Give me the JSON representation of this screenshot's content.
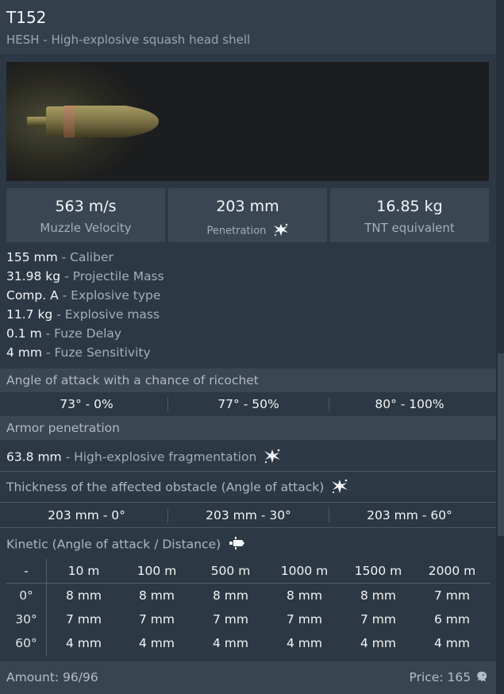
{
  "header": {
    "title": "T152",
    "subtitle": "HESH - High-explosive squash head shell"
  },
  "stats": [
    {
      "value": "563 m/s",
      "label": "Muzzle Velocity"
    },
    {
      "value": "203 mm",
      "label": "Penetration",
      "icon": "explosion-icon"
    },
    {
      "value": "16.85 kg",
      "label": "TNT equivalent"
    }
  ],
  "properties": [
    {
      "value": "155 mm",
      "desc": "- Caliber"
    },
    {
      "value": "31.98 kg",
      "desc": "- Projectile Mass"
    },
    {
      "value": "Comp. A",
      "desc": "- Explosive type"
    },
    {
      "value": "11.7 kg",
      "desc": "- Explosive mass"
    },
    {
      "value": "0.1 m",
      "desc": "- Fuze Delay"
    },
    {
      "value": "4 mm",
      "desc": "- Fuze Sensitivity"
    }
  ],
  "ricochet": {
    "title": "Angle of attack with a chance of ricochet",
    "cells": [
      "73° - 0%",
      "77° - 50%",
      "80° - 100%"
    ]
  },
  "armor": {
    "title": "Armor penetration",
    "frag_value": "63.8 mm",
    "frag_desc": "- High-explosive fragmentation",
    "thickness_title": "Thickness of the affected obstacle (Angle of attack)",
    "thickness_cells": [
      "203 mm - 0°",
      "203 mm - 30°",
      "203 mm - 60°"
    ],
    "kinetic_title": "Kinetic (Angle of attack / Distance)"
  },
  "kinetic_table": {
    "corner": "-",
    "distances": [
      "10 m",
      "100 m",
      "500 m",
      "1000 m",
      "1500 m",
      "2000 m"
    ],
    "rows": [
      {
        "angle": "0°",
        "values": [
          "8 mm",
          "8 mm",
          "8 mm",
          "8 mm",
          "8 mm",
          "7 mm"
        ]
      },
      {
        "angle": "30°",
        "values": [
          "7 mm",
          "7 mm",
          "7 mm",
          "7 mm",
          "7 mm",
          "6 mm"
        ]
      },
      {
        "angle": "60°",
        "values": [
          "4 mm",
          "4 mm",
          "4 mm",
          "4 mm",
          "4 mm",
          "4 mm"
        ]
      }
    ]
  },
  "footer": {
    "amount": "Amount: 96/96",
    "price": "Price: 165",
    "price_icon": "silver-lion-icon"
  },
  "colors": {
    "background": "#2c3843",
    "header": "#333f4b",
    "section": "#3a4652",
    "text": "#f2f4f6",
    "muted": "#a3afba"
  }
}
